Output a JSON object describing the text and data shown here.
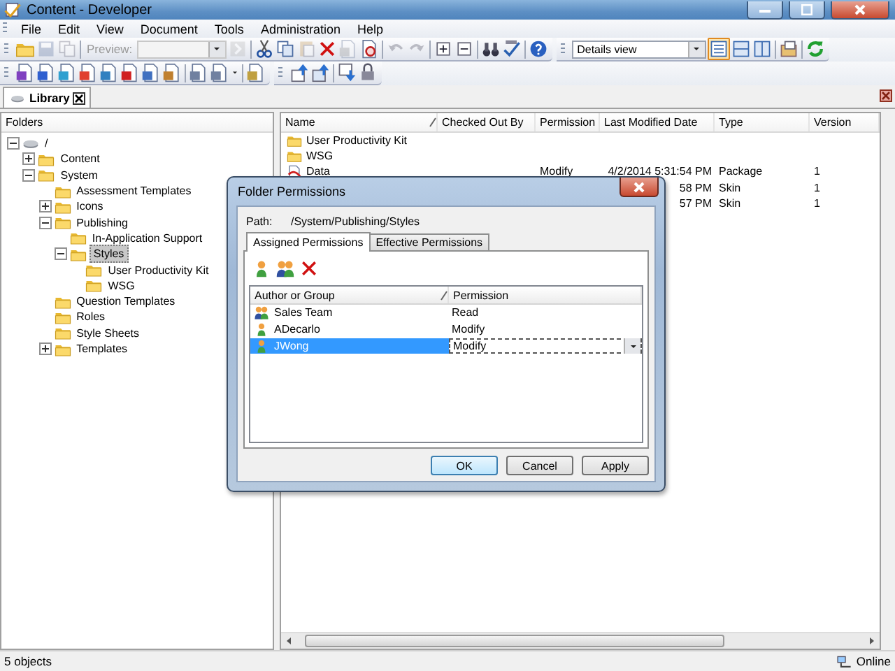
{
  "window": {
    "title": "Content - Developer"
  },
  "menu": [
    "File",
    "Edit",
    "View",
    "Document",
    "Tools",
    "Administration",
    "Help"
  ],
  "toolbar": {
    "preview": {
      "label": "Preview:",
      "disabled": true
    },
    "view_select": "Details view"
  },
  "document_tab": {
    "label": "Library"
  },
  "folders": {
    "header": "Folders",
    "tree": [
      {
        "label": "/",
        "kind": "drive",
        "expanded": true,
        "selected": false,
        "children": [
          {
            "label": "Content",
            "kind": "folder",
            "expanded": false,
            "selected": false
          },
          {
            "label": "System",
            "kind": "folder",
            "expanded": true,
            "selected": false,
            "children": [
              {
                "label": "Assessment Templates",
                "kind": "folder",
                "selected": false
              },
              {
                "label": "Icons",
                "kind": "folder",
                "expanded": false,
                "selected": false
              },
              {
                "label": "Publishing",
                "kind": "folder",
                "expanded": true,
                "selected": false,
                "children": [
                  {
                    "label": "In-Application Support",
                    "kind": "folder",
                    "selected": false
                  },
                  {
                    "label": "Styles",
                    "kind": "folder",
                    "expanded": true,
                    "selected": true,
                    "children": [
                      {
                        "label": "User Productivity Kit",
                        "kind": "folder",
                        "selected": false
                      },
                      {
                        "label": "WSG",
                        "kind": "folder",
                        "selected": false
                      }
                    ]
                  }
                ]
              },
              {
                "label": "Question Templates",
                "kind": "folder",
                "selected": false
              },
              {
                "label": "Roles",
                "kind": "folder",
                "selected": false
              },
              {
                "label": "Style Sheets",
                "kind": "folder",
                "selected": false
              },
              {
                "label": "Templates",
                "kind": "folder",
                "expanded": false,
                "selected": false
              }
            ]
          }
        ]
      }
    ]
  },
  "table": {
    "columns": [
      "Name",
      "Checked Out By",
      "Permission",
      "Last Modified Date",
      "Type",
      "Version"
    ],
    "rows": [
      {
        "kind": "folder",
        "name": "User Productivity Kit"
      },
      {
        "kind": "folder",
        "name": "WSG"
      },
      {
        "kind": "package",
        "name": "Data",
        "permission": "Modify",
        "modified": "4/2/2014 5:31:54 PM",
        "type": "Package",
        "version": "1"
      },
      {
        "modified": "58 PM",
        "type": "Skin",
        "version": "1"
      },
      {
        "modified": "57 PM",
        "type": "Skin",
        "version": "1"
      }
    ]
  },
  "dialog": {
    "title": "Folder Permissions",
    "path_label": "Path:",
    "path": "/System/Publishing/Styles",
    "tabs": [
      {
        "label": "Assigned Permissions",
        "selected": true
      },
      {
        "label": "Effective Permissions",
        "selected": false
      }
    ],
    "columns": [
      "Author or Group",
      "Permission"
    ],
    "rows": [
      {
        "kind": "group",
        "name": "Sales Team",
        "permission": "Read",
        "selected": false
      },
      {
        "kind": "user",
        "name": "ADecarlo",
        "permission": "Modify",
        "selected": false
      },
      {
        "kind": "user",
        "name": "JWong",
        "permission": "Modify",
        "selected": true
      }
    ],
    "buttons": [
      {
        "label": "OK",
        "default": true
      },
      {
        "label": "Cancel",
        "default": false
      },
      {
        "label": "Apply",
        "default": false
      }
    ]
  },
  "status_bar": {
    "left": "5 objects",
    "right": "Online"
  }
}
